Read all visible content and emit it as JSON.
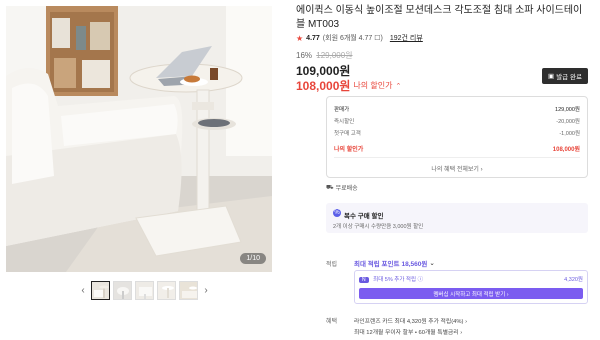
{
  "gallery": {
    "counter": "1/10",
    "thumb_count": 5,
    "prev_icon": "chevron-left-icon",
    "next_icon": "chevron-right-icon"
  },
  "product": {
    "title": "에이퀵스 이동식 높이조절 모션데스크 각도조절 침대 소파 사이드테이블 MT003",
    "rating": "4.77",
    "rating_detail": "(회원 6개월 4.77 ☐)",
    "reviews": "192건 리뷰"
  },
  "pricing": {
    "discount_pct": "16%",
    "original": "129,000원",
    "price": "109,000원",
    "sale_price": "108,000원",
    "sale_label": "나의 할인가",
    "coupon_button": "발급 완료"
  },
  "price_box": {
    "rows": [
      {
        "label": "판매가",
        "value": "129,000원"
      },
      {
        "label": "즉시할인",
        "value": "-20,000원"
      },
      {
        "label": "첫구매 고객",
        "value": "-1,000원"
      }
    ],
    "mine_label": "나의 할인가",
    "mine_value": "108,000원",
    "more_link": "나의 혜택 전체보기 ›"
  },
  "shipping": {
    "label": "무료배송"
  },
  "bulk": {
    "title": "복수 구매 할인",
    "subtitle": "2개 이상 구매시 수량만큼 3,000원 할인"
  },
  "points": {
    "label": "적립",
    "headline_prefix": "최대 적립 포인트 ",
    "headline_value": "18,560원",
    "card_badge": "N",
    "card_text": "최대 5% 추가 적립 ⓘ",
    "card_value": "4,320원",
    "button": "멤버십 시작하고 최대 적립 받기 ›"
  },
  "benefits": {
    "label": "혜택",
    "line1": "라인프렌즈 카드 최대 4,320원 추가 적립(4%) ›",
    "line2": "최대 12개월 무이자 할부 • 60개월 특별금리 ›"
  },
  "colors": {
    "accent_red": "#e8463b",
    "accent_purple": "#6a5ae0"
  }
}
